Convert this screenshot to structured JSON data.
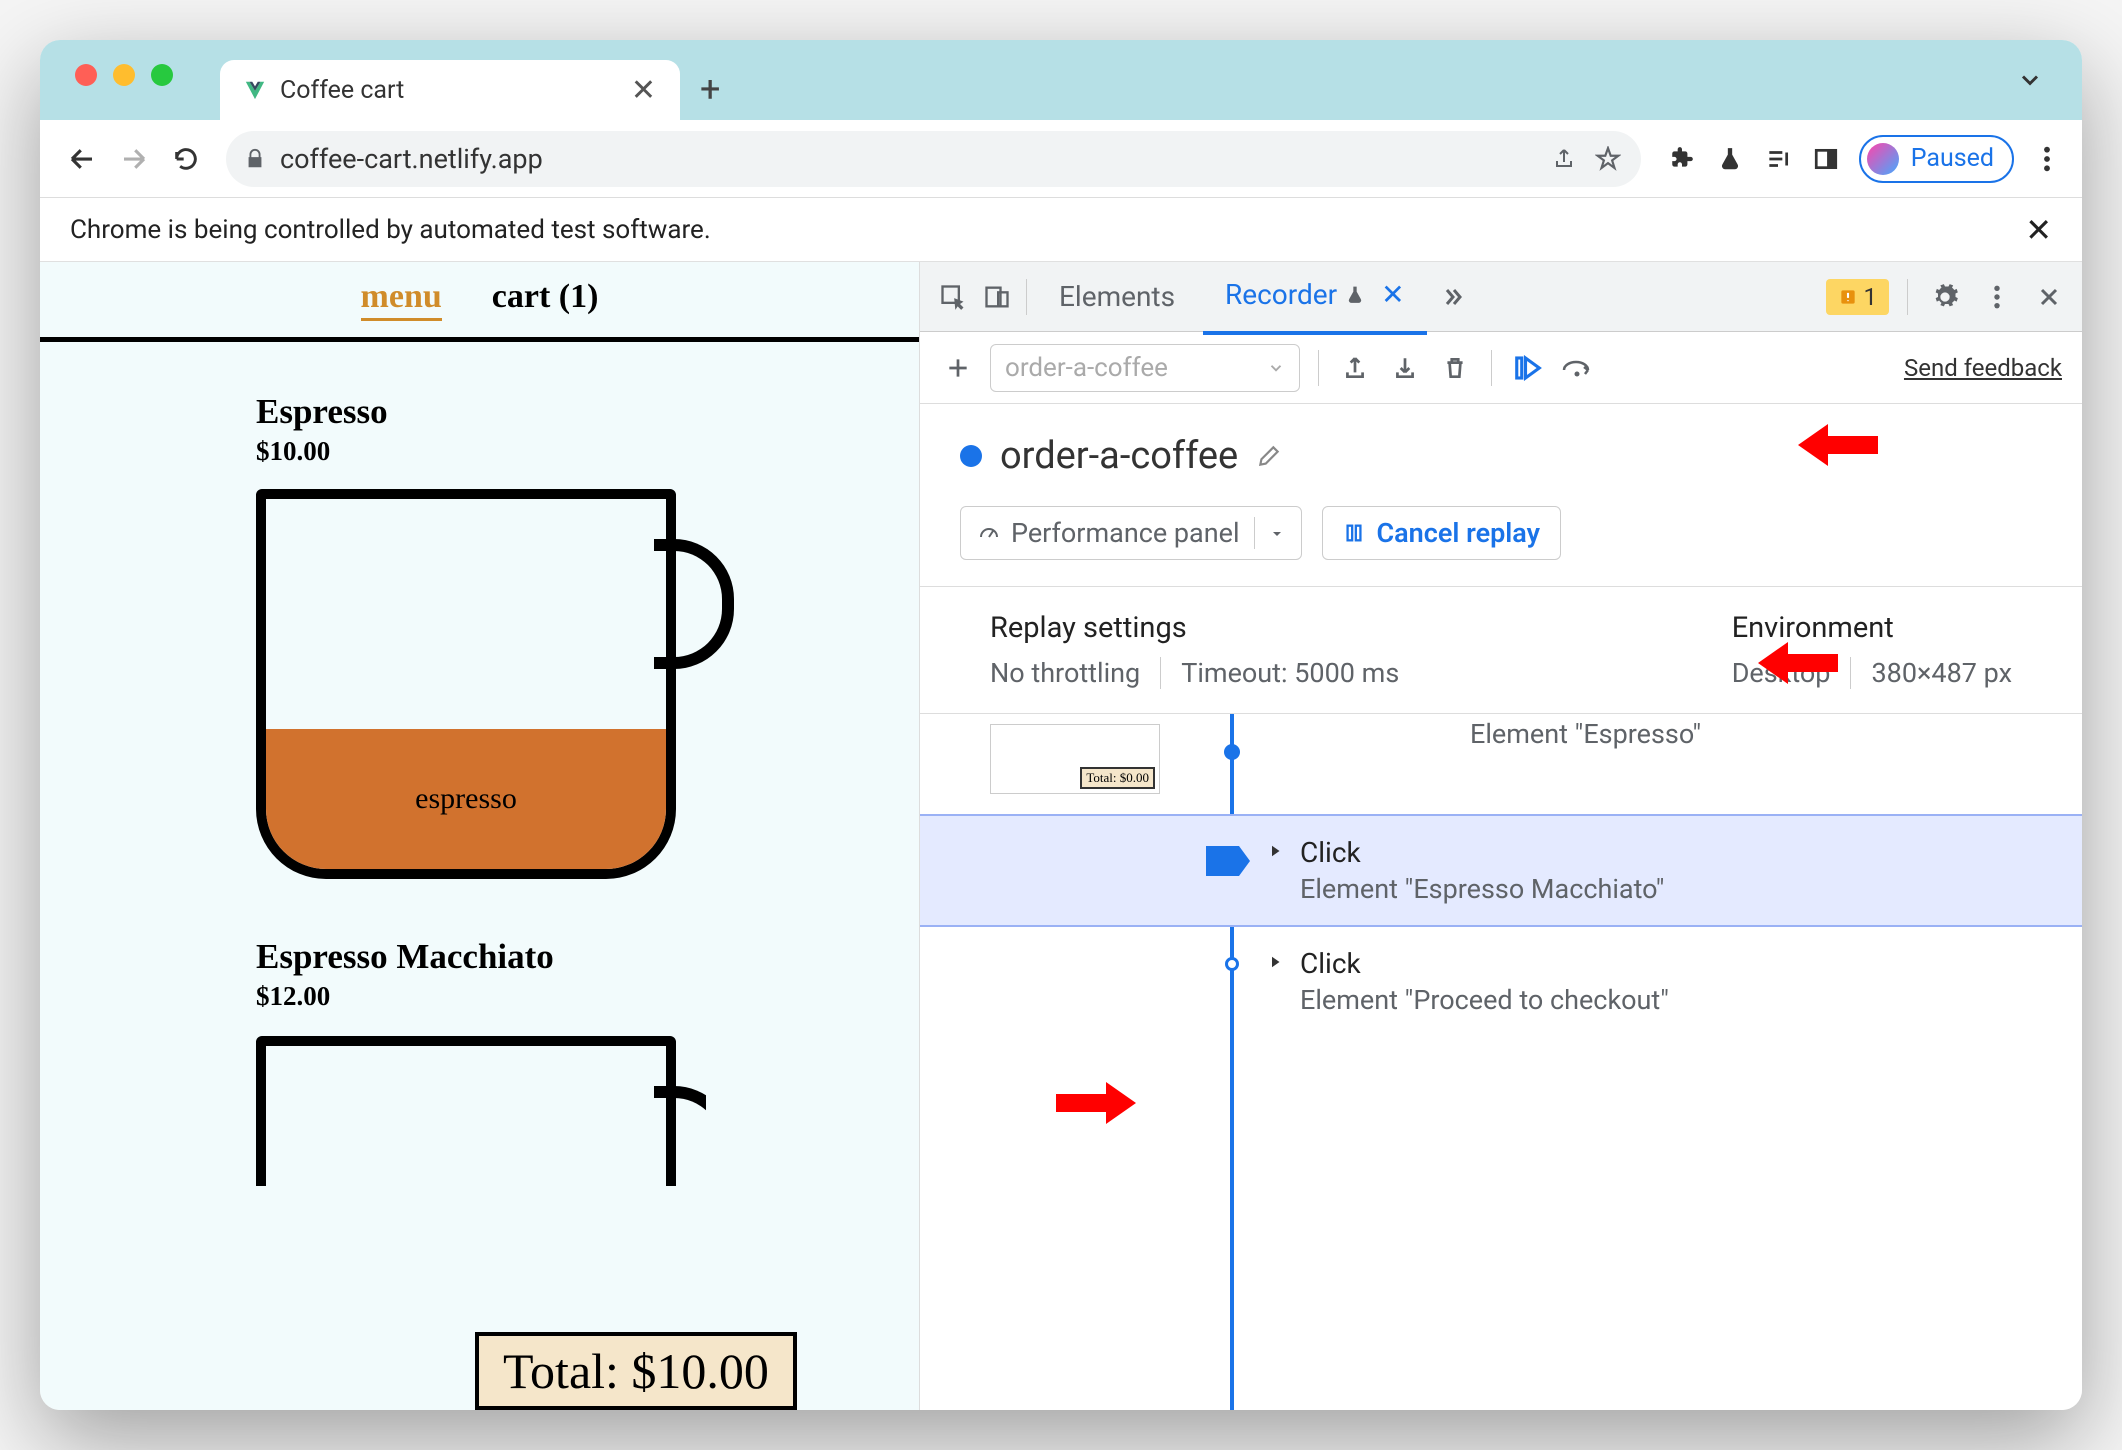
{
  "browser": {
    "tab_title": "Coffee cart",
    "url": "coffee-cart.netlify.app",
    "paused_label": "Paused",
    "banner": "Chrome is being controlled by automated test software."
  },
  "page": {
    "nav_menu": "menu",
    "nav_cart": "cart (1)",
    "product1_name": "Espresso",
    "product1_price": "$10.00",
    "cup_label": "espresso",
    "product2_name": "Espresso Macchiato",
    "product2_price": "$12.00",
    "total_label": "Total: $10.00"
  },
  "devtools": {
    "tab_elements": "Elements",
    "tab_recorder": "Recorder",
    "issues_count": "1",
    "recording_dropdown": "order-a-coffee",
    "send_feedback": "Send feedback",
    "recording_title": "order-a-coffee",
    "perf_panel": "Performance panel",
    "cancel_replay": "Cancel replay",
    "replay_settings_title": "Replay settings",
    "throttling": "No throttling",
    "timeout": "Timeout: 5000 ms",
    "environment_title": "Environment",
    "env_device": "Desktop",
    "env_size": "380×487 px",
    "step1_sub": "Element \"Espresso\"",
    "step1_thumb_total": "Total: $0.00",
    "step2_title": "Click",
    "step2_sub": "Element \"Espresso Macchiato\"",
    "step3_title": "Click",
    "step3_sub": "Element \"Proceed to checkout\""
  }
}
